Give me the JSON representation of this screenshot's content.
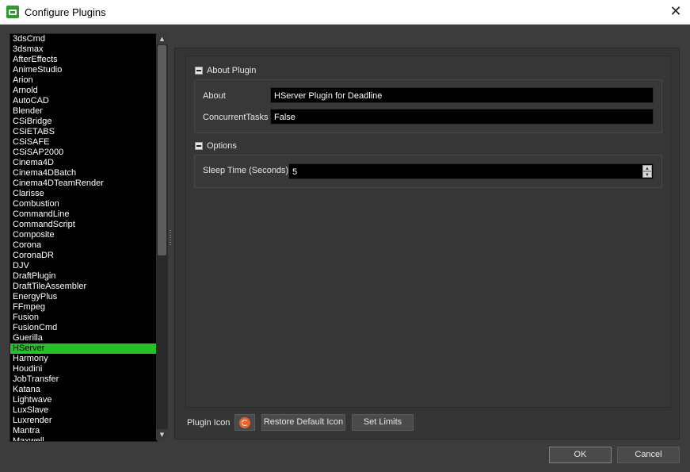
{
  "window": {
    "title": "Configure Plugins",
    "icon": "deadline-monitor-icon",
    "close_label": "✕"
  },
  "plugins": {
    "items": [
      "3dsCmd",
      "3dsmax",
      "AfterEffects",
      "AnimeStudio",
      "Arion",
      "Arnold",
      "AutoCAD",
      "Blender",
      "CSiBridge",
      "CSiETABS",
      "CSiSAFE",
      "CSiSAP2000",
      "Cinema4D",
      "Cinema4DBatch",
      "Cinema4DTeamRender",
      "Clarisse",
      "Combustion",
      "CommandLine",
      "CommandScript",
      "Composite",
      "Corona",
      "CoronaDR",
      "DJV",
      "DraftPlugin",
      "DraftTileAssembler",
      "EnergyPlus",
      "FFmpeg",
      "Fusion",
      "FusionCmd",
      "Guerilla",
      "HServer",
      "Harmony",
      "Houdini",
      "JobTransfer",
      "Katana",
      "Lightwave",
      "LuxSlave",
      "Luxrender",
      "Mantra",
      "Maxwell"
    ],
    "selected": "HServer",
    "selected_color": "#27c027"
  },
  "about_section": {
    "header": "About Plugin",
    "about_label": "About",
    "about_value": "HServer Plugin for Deadline",
    "concurrent_label": "ConcurrentTasks",
    "concurrent_value": "False"
  },
  "options_section": {
    "header": "Options",
    "sleep_label": "Sleep Time (Seconds)",
    "sleep_value": "5"
  },
  "footer": {
    "plugin_icon_label": "Plugin Icon",
    "plugin_icon": "houdini-icon",
    "restore_label": "Restore Default Icon",
    "limits_label": "Set Limits",
    "ok_label": "OK",
    "cancel_label": "Cancel"
  }
}
